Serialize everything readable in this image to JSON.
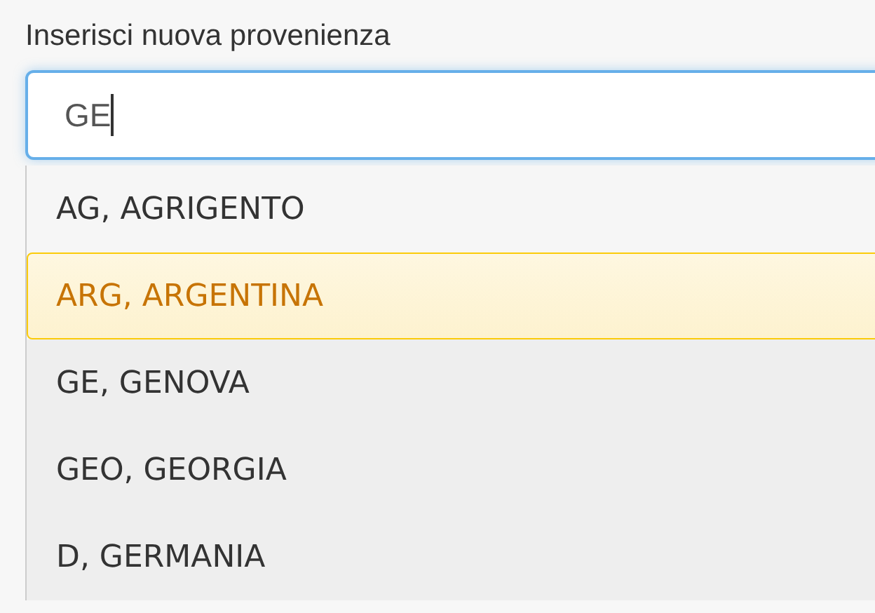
{
  "field": {
    "label": "Inserisci nuova provenienza",
    "value": "GE"
  },
  "suggestions": [
    {
      "label": "AG, AGRIGENTO",
      "selected": false
    },
    {
      "label": "ARG, ARGENTINA",
      "selected": true
    },
    {
      "label": "GE, GENOVA",
      "selected": false
    },
    {
      "label": "GEO, GEORGIA",
      "selected": false
    },
    {
      "label": "D, GERMANIA",
      "selected": false
    }
  ]
}
